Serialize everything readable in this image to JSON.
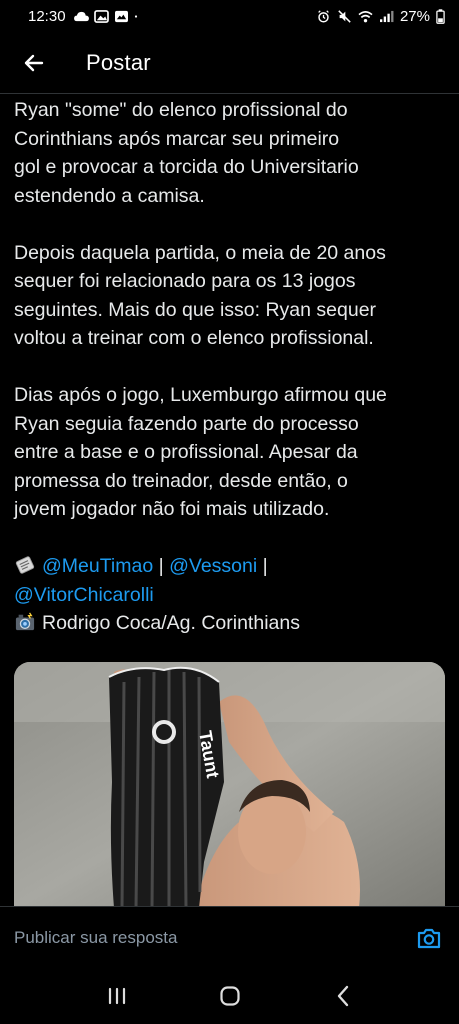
{
  "status_bar": {
    "time": "12:30",
    "battery": "27%"
  },
  "header": {
    "title": "Postar"
  },
  "post": {
    "paragraphs": [
      "Ryan \"some\" do elenco profissional do\nCorinthians após marcar seu primeiro\ngol e provocar a torcida do Universitario\nestendendo a camisa.",
      "Depois daquela partida, o meia de 20 anos\nsequer foi relacionado para os 13 jogos\nseguintes. Mais do que isso: Ryan sequer\nvoltou a treinar com o elenco profissional.",
      "Dias após o jogo, Luxemburgo afirmou que\nRyan seguia fazendo parte do processo\nentre a base e o profissional. Apesar da\npromessa do treinador, desde então, o\njovem jogador não foi mais utilizado."
    ],
    "credits": {
      "mention_1": "@MeuTimao",
      "separator_1": " | ",
      "mention_2": "@Vessoni",
      "separator_2": " |",
      "mention_3": "@VitorChicarolli",
      "photo_credit": "Rodrigo Coca/Ag. Corinthians"
    },
    "media": {
      "jersey_text": "Taunt"
    }
  },
  "reply": {
    "placeholder": "Publicar sua resposta"
  },
  "icons": {
    "back": "arrow-left-icon",
    "newspaper": "newspaper-icon",
    "camera_emoji": "camera-flash-icon",
    "camera": "camera-icon",
    "nav_recents": "recents-icon",
    "nav_home": "home-icon",
    "nav_back": "chevron-left-icon"
  },
  "colors": {
    "link": "#1d9bf0",
    "background": "#000000",
    "text": "#e7e9ea"
  }
}
